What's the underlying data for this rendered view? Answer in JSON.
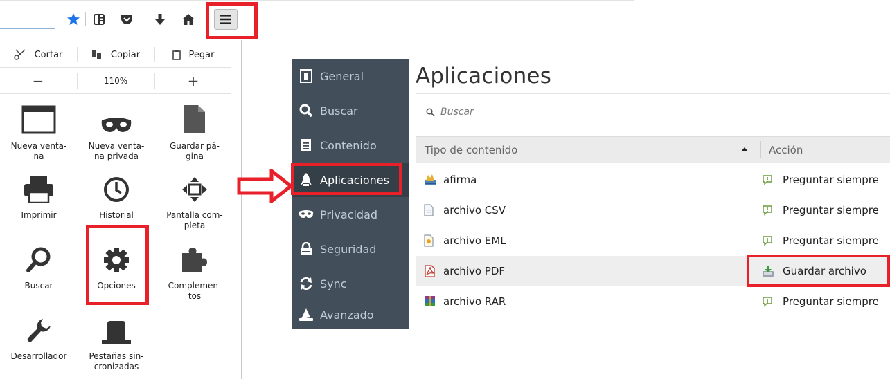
{
  "toolbar": {
    "icons": [
      "bookmark-star-icon",
      "reading-list-icon",
      "pocket-icon",
      "download-icon",
      "home-icon",
      "hamburger-menu-icon"
    ]
  },
  "menu_panel": {
    "edit": {
      "cut": "Cortar",
      "copy": "Copiar",
      "paste": "Pegar"
    },
    "zoom": {
      "minus": "−",
      "level": "110%",
      "plus": "+"
    },
    "tiles": [
      {
        "label": "Nueva venta-\nna",
        "icon": "new-window-icon"
      },
      {
        "label": "Nueva venta-\nna privada",
        "icon": "private-mask-icon"
      },
      {
        "label": "Guardar pá-\ngina",
        "icon": "save-page-icon"
      },
      {
        "label": "Imprimir",
        "icon": "printer-icon"
      },
      {
        "label": "Historial",
        "icon": "clock-icon"
      },
      {
        "label": "Pantalla com-\npleta",
        "icon": "fullscreen-icon"
      },
      {
        "label": "Buscar",
        "icon": "search-icon"
      },
      {
        "label": "Opciones",
        "icon": "gear-icon"
      },
      {
        "label": "Complemen-\ntos",
        "icon": "puzzle-icon"
      },
      {
        "label": "Desarrollador",
        "icon": "wrench-icon"
      },
      {
        "label": "Pestañas sin-\ncronizadas",
        "icon": "synced-tabs-icon"
      }
    ]
  },
  "prefs": {
    "sidebar": [
      {
        "label": "General",
        "icon": "general-switch-icon"
      },
      {
        "label": "Buscar",
        "icon": "search-icon"
      },
      {
        "label": "Contenido",
        "icon": "document-icon"
      },
      {
        "label": "Aplicaciones",
        "icon": "rocket-icon",
        "active": true
      },
      {
        "label": "Privacidad",
        "icon": "mask-icon"
      },
      {
        "label": "Seguridad",
        "icon": "lock-icon"
      },
      {
        "label": "Sync",
        "icon": "sync-icon"
      },
      {
        "label": "Avanzado",
        "icon": "wizard-hat-icon"
      }
    ],
    "title": "Aplicaciones",
    "search_placeholder": "Buscar",
    "table": {
      "col_type": "Tipo de contenido",
      "col_action": "Acción",
      "rows": [
        {
          "type": "afirma",
          "action": "Preguntar siempre",
          "type_icon": "afirma-app-icon",
          "action_icon": "ask-icon"
        },
        {
          "type": "archivo CSV",
          "action": "Preguntar siempre",
          "type_icon": "csv-file-icon",
          "action_icon": "ask-icon"
        },
        {
          "type": "archivo EML",
          "action": "Preguntar siempre",
          "type_icon": "eml-file-icon",
          "action_icon": "ask-icon"
        },
        {
          "type": "archivo PDF",
          "action": "Guardar archivo",
          "type_icon": "pdf-file-icon",
          "action_icon": "save-file-icon",
          "selected": true
        },
        {
          "type": "archivo RAR",
          "action": "Preguntar siempre",
          "type_icon": "rar-file-icon",
          "action_icon": "ask-icon"
        }
      ]
    }
  },
  "colors": {
    "highlight": "#e8202a",
    "sidebar_bg": "#424f5a",
    "sidebar_active": "#343f48",
    "bookmark_blue": "#1a73e8"
  }
}
